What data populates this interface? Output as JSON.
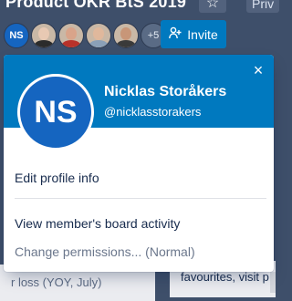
{
  "board": {
    "title": "Product OKR BtS 2019",
    "star_icon": "☆",
    "visibility_label": "Priv"
  },
  "members": {
    "current_initials": "NS",
    "more_count": "+5",
    "photos": [
      {
        "head": "#e8c9b3",
        "body": "#2b2b2b"
      },
      {
        "head": "#d9a48a",
        "body": "#b8322a"
      },
      {
        "head": "#e0b89c",
        "body": "#8aa0b8"
      },
      {
        "head": "#c89678",
        "body": "#3a3a3a"
      }
    ]
  },
  "invite": {
    "label": "Invite",
    "icon": "person-plus"
  },
  "popover": {
    "initials": "NS",
    "full_name": "Nicklas Storåkers",
    "username": "@nicklasstorakers",
    "close_icon": "×",
    "items": {
      "edit_profile": "Edit profile info",
      "view_activity": "View member's board activity",
      "change_permissions": "Change permissions... (Normal)"
    }
  },
  "background": {
    "left_card_text": "r loss (YOY, July)",
    "right_card_text": "favourites, visit p"
  },
  "colors": {
    "header_blue": "#0079bf",
    "avatar_blue": "#1565c0",
    "board_bg": "#3e4f6a"
  }
}
